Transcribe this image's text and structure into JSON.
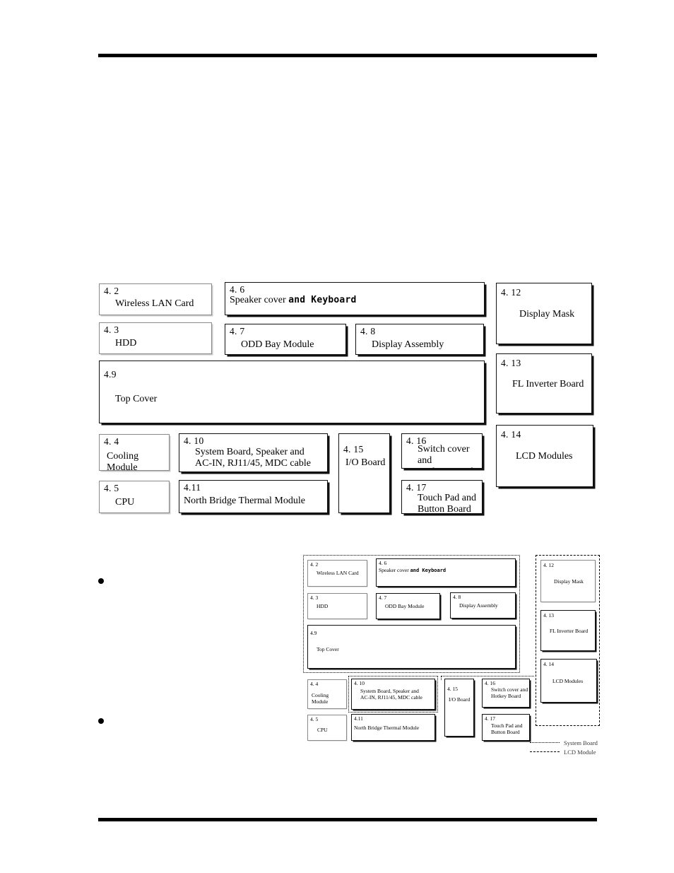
{
  "page": {
    "rules": {
      "top": "horizontal-rule",
      "bottom": "horizontal-rule"
    }
  },
  "main_diagram": {
    "boxes": [
      {
        "id": "4-2",
        "num": "4. 2",
        "label": "Wireless LAN Card",
        "style": "light",
        "indent": true
      },
      {
        "id": "4-6",
        "num": "4. 6",
        "label": "Speaker cover ",
        "label_mono": "and Keyboard",
        "style": "heavy",
        "indent": false
      },
      {
        "id": "4-3",
        "num": "4. 3",
        "label": "HDD",
        "style": "light",
        "indent": true
      },
      {
        "id": "4-7",
        "num": "4. 7",
        "label": "ODD Bay Module",
        "style": "heavy",
        "indent": true
      },
      {
        "id": "4-8",
        "num": "4. 8",
        "label": "Display Assembly",
        "style": "heavy",
        "indent": true
      },
      {
        "id": "4-9",
        "num": "4.9",
        "label": "Top Cover",
        "style": "heavy",
        "indent": true
      },
      {
        "id": "4-4",
        "num": "4. 4",
        "label": "Cooling Module",
        "style": "light",
        "indent": false
      },
      {
        "id": "4-10",
        "num": "4. 10",
        "label": "System Board, Speaker and\nAC-IN, RJ11/45, MDC cable",
        "style": "heavy",
        "indent": true
      },
      {
        "id": "4-15",
        "num": "4. 15",
        "label": "I/O Board",
        "style": "heavy",
        "indent": false
      },
      {
        "id": "4-16",
        "num": "4. 16",
        "label": "Switch cover and\nHotkey Board",
        "style": "heavy",
        "indent": true
      },
      {
        "id": "4-5",
        "num": "4. 5",
        "label": "CPU",
        "style": "light",
        "indent": false
      },
      {
        "id": "4-11",
        "num": "4.11",
        "label": "North Bridge Thermal  Module",
        "style": "heavy",
        "indent": false
      },
      {
        "id": "4-17",
        "num": "4. 17",
        "label": "Touch Pad and\nButton Board",
        "style": "heavy",
        "indent": true
      },
      {
        "id": "4-12",
        "num": "4. 12",
        "label": "Display Mask",
        "style": "heavy",
        "indent": true
      },
      {
        "id": "4-13",
        "num": "4. 13",
        "label": "FL Inverter Board",
        "style": "heavy",
        "indent": true
      },
      {
        "id": "4-14",
        "num": "4. 14",
        "label": "LCD Modules",
        "style": "heavy",
        "indent": true
      }
    ]
  },
  "thumbnail": {
    "boxes": [
      {
        "id": "4-2",
        "num": "4. 2",
        "label": "Wireless LAN Card",
        "style": "light",
        "indent": true
      },
      {
        "id": "4-6",
        "num": "4. 6",
        "label": "Speaker cover ",
        "label_mono": "and Keyboard",
        "style": "heavy",
        "indent": false
      },
      {
        "id": "4-3",
        "num": "4. 3",
        "label": "HDD",
        "style": "light",
        "indent": true
      },
      {
        "id": "4-7",
        "num": "4. 7",
        "label": "ODD Bay Module",
        "style": "heavy",
        "indent": true
      },
      {
        "id": "4-8",
        "num": "4. 8",
        "label": "Display Assembly",
        "style": "heavy",
        "indent": true
      },
      {
        "id": "4-9",
        "num": "4.9",
        "label": "Top Cover",
        "style": "heavy",
        "indent": true
      },
      {
        "id": "4-4",
        "num": "4. 4",
        "label": "Cooling Module",
        "style": "light",
        "indent": false
      },
      {
        "id": "4-10",
        "num": "4. 10",
        "label": "System Board, Speaker and\nAC-IN, RJ11/45, MDC cable",
        "style": "heavy",
        "indent": true
      },
      {
        "id": "4-15",
        "num": "4. 15",
        "label": "I/O Board",
        "style": "heavy",
        "indent": false
      },
      {
        "id": "4-16",
        "num": "4. 16",
        "label": "Switch cover and\nHotkey Board",
        "style": "heavy",
        "indent": true
      },
      {
        "id": "4-5",
        "num": "4. 5",
        "label": "CPU",
        "style": "light",
        "indent": false
      },
      {
        "id": "4-11",
        "num": "4.11",
        "label": "North Bridge Thermal  Module",
        "style": "heavy",
        "indent": false
      },
      {
        "id": "4-17",
        "num": "4. 17",
        "label": "Touch Pad and\nButton Board",
        "style": "heavy",
        "indent": true
      },
      {
        "id": "4-12",
        "num": "4. 12",
        "label": "Display Mask",
        "style": "heavy",
        "indent": true
      },
      {
        "id": "4-13",
        "num": "4. 13",
        "label": "FL Inverter Board",
        "style": "heavy",
        "indent": true
      },
      {
        "id": "4-14",
        "num": "4. 14",
        "label": "LCD Modules",
        "style": "heavy",
        "indent": true
      }
    ]
  },
  "legend": {
    "items": [
      {
        "line": "dotted",
        "label": "System Board"
      },
      {
        "line": "dashdot",
        "label": "LCD Module"
      }
    ]
  }
}
